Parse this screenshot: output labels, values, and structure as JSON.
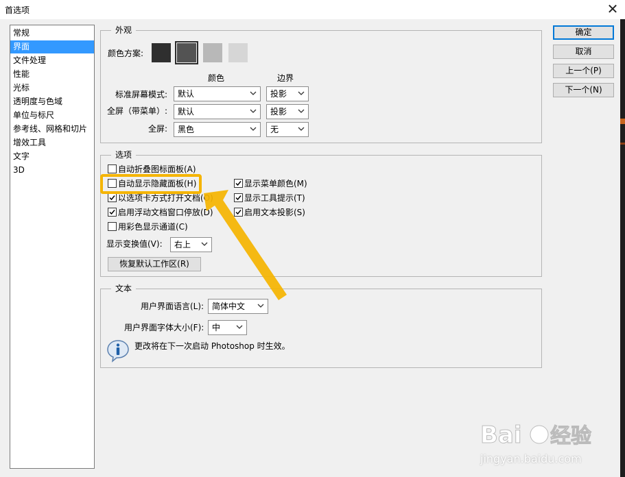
{
  "window": {
    "title": "首选项",
    "close_glyph": "✕"
  },
  "categories": [
    "常规",
    "界面",
    "文件处理",
    "性能",
    "光标",
    "透明度与色域",
    "单位与标尺",
    "参考线、网格和切片",
    "增效工具",
    "文字",
    "3D"
  ],
  "selected_category_index": 1,
  "appearance": {
    "legend": "外观",
    "color_scheme_label": "颜色方案:",
    "swatches": [
      "#2f2f2f",
      "#535353",
      "#b8b8b8",
      "#d6d6d6"
    ],
    "selected_swatch_index": 1,
    "col_color": "颜色",
    "col_border": "边界",
    "rows": [
      {
        "label": "标准屏幕模式:",
        "color": "默认",
        "border": "投影"
      },
      {
        "label": "全屏（带菜单）:",
        "color": "默认",
        "border": "投影"
      },
      {
        "label": "全屏:",
        "color": "黑色",
        "border": "无"
      }
    ]
  },
  "options": {
    "legend": "选项",
    "left": [
      {
        "label": "自动折叠图标面板(A)",
        "checked": false
      },
      {
        "label": "自动显示隐藏面板(H)",
        "checked": false
      },
      {
        "label": "以选项卡方式打开文档(O)",
        "checked": true
      },
      {
        "label": "启用浮动文档窗口停放(D)",
        "checked": true
      },
      {
        "label": "用彩色显示通道(C)",
        "checked": false
      }
    ],
    "right": [
      {
        "label": "显示菜单颜色(M)",
        "checked": true
      },
      {
        "label": "显示工具提示(T)",
        "checked": true
      },
      {
        "label": "启用文本投影(S)",
        "checked": true
      }
    ],
    "transform_label": "显示变换值(V):",
    "transform_value": "右上",
    "reset_button": "恢复默认工作区(R)"
  },
  "text_section": {
    "legend": "文本",
    "lang_label": "用户界面语言(L):",
    "lang_value": "简体中文",
    "size_label": "用户界面字体大小(F):",
    "size_value": "中",
    "note": "更改将在下一次启动 Photoshop 时生效。"
  },
  "buttons": {
    "ok": "确定",
    "cancel": "取消",
    "prev": "上一个(P)",
    "next": "下一个(N)"
  },
  "watermark": {
    "text": "jingyan.baidu.com"
  },
  "colors": {
    "highlight": "#f5b400",
    "selection": "#3399ff"
  }
}
